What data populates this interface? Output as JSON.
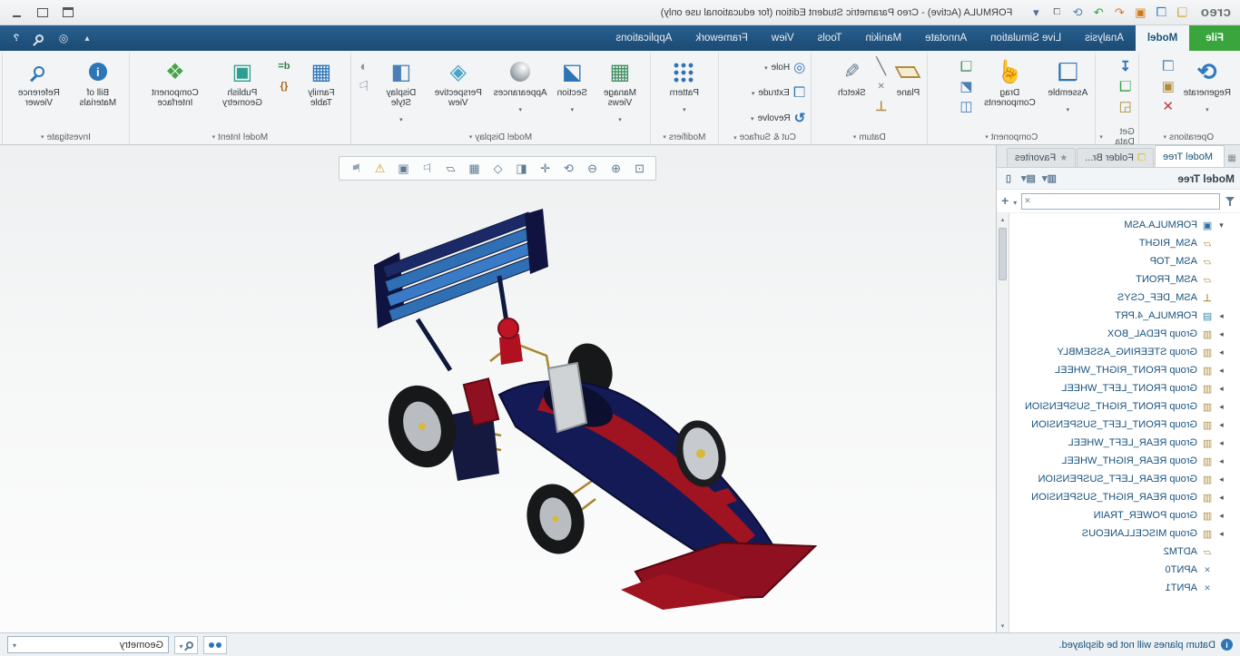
{
  "window": {
    "logo": "creo",
    "title": "FORMULA (Active) - Creo Parametric Student Edition (for educational use only)"
  },
  "qat_icons": [
    {
      "name": "new-icon",
      "glyph": "❏"
    },
    {
      "name": "open-icon",
      "glyph": "❒"
    },
    {
      "name": "save-icon",
      "glyph": "▣"
    },
    {
      "name": "undo-icon",
      "glyph": "↶"
    },
    {
      "name": "redo-icon",
      "glyph": "↷"
    },
    {
      "name": "regenerate-quick-icon",
      "glyph": "⟳"
    },
    {
      "name": "windows-icon",
      "glyph": "❐"
    },
    {
      "name": "customize-toolbar-icon",
      "glyph": "▾"
    }
  ],
  "tabbar_icon_names": [
    "minimize-ribbon-icon",
    "target-icon",
    "command-search-icon",
    "help-icon"
  ],
  "ribbon": {
    "tabs": [
      {
        "name": "tab-file",
        "label": "File",
        "state": "file"
      },
      {
        "name": "tab-model",
        "label": "Model",
        "state": "active"
      },
      {
        "name": "tab-analysis",
        "label": "Analysis",
        "state": "normal"
      },
      {
        "name": "tab-live-simulation",
        "label": "Live Simulation",
        "state": "normal"
      },
      {
        "name": "tab-annotate",
        "label": "Annotate",
        "state": "normal"
      },
      {
        "name": "tab-manikin",
        "label": "Manikin",
        "state": "normal"
      },
      {
        "name": "tab-tools",
        "label": "Tools",
        "state": "normal"
      },
      {
        "name": "tab-view",
        "label": "View",
        "state": "normal"
      },
      {
        "name": "tab-framework",
        "label": "Framework",
        "state": "normal"
      },
      {
        "name": "tab-applications",
        "label": "Applications",
        "state": "normal"
      }
    ],
    "groups": {
      "operations": {
        "label": "Operations",
        "regenerate": "Regenerate"
      },
      "get_data": {
        "label": "Get Data"
      },
      "component": {
        "label": "Component",
        "assemble": "Assemble",
        "drag": "Drag Components"
      },
      "datum": {
        "label": "Datum",
        "plane": "Plane",
        "sketch": "Sketch"
      },
      "cut_surface": {
        "label": "Cut & Surface",
        "hole": "Hole",
        "extrude": "Extrude",
        "revolve": "Revolve"
      },
      "modifiers": {
        "label": "Modifiers",
        "pattern": "Pattern"
      },
      "model_display": {
        "label": "Model Display",
        "manage_views": "Manage Views",
        "section": "Section",
        "appearances": "Appearances",
        "perspective": "Perspective View",
        "display_style": "Display Style"
      },
      "model_intent": {
        "label": "Model Intent",
        "family_table": "Family Table",
        "publish_geometry": "Publish Geometry",
        "component_interface": "Component Interface"
      },
      "investigate": {
        "label": "Investigate",
        "bom": "Bill of Materials",
        "reference_viewer": "Reference Viewer"
      }
    }
  },
  "navigator": {
    "tabs": [
      {
        "name": "tab-model-tree",
        "label": "Model Tree",
        "state": "active",
        "glyph": ""
      },
      {
        "name": "tab-folder-browser",
        "label": "Folder Br...",
        "state": "normal",
        "glyph": "❒"
      },
      {
        "name": "tab-favorites",
        "label": "Favorites",
        "state": "normal",
        "glyph": "★"
      }
    ],
    "panel_title": "Model Tree",
    "header_icons": [
      {
        "name": "tree-settings-icon",
        "glyph": "▥▾"
      },
      {
        "name": "tree-display-icon",
        "glyph": "▤▾"
      },
      {
        "name": "tree-column-icon",
        "glyph": "▯"
      }
    ],
    "search_value": ""
  },
  "tree": {
    "items": [
      {
        "label": "FORMULA.ASM",
        "type": "asm",
        "expander": "expanded"
      },
      {
        "label": "ASM_RIGHT",
        "type": "plane",
        "expander": "none"
      },
      {
        "label": "ASM_TOP",
        "type": "plane",
        "expander": "none"
      },
      {
        "label": "ASM_FRONT",
        "type": "plane",
        "expander": "none"
      },
      {
        "label": "ASM_DEF_CSYS",
        "type": "csys",
        "expander": "none"
      },
      {
        "label": "FORMULA_4.PRT",
        "type": "part",
        "expander": "collapsed"
      },
      {
        "label": "Group PEDAL_BOX",
        "type": "group",
        "expander": "collapsed"
      },
      {
        "label": "Group STEERING_ASSEMBLY",
        "type": "group",
        "expander": "collapsed"
      },
      {
        "label": "Group FRONT_RIGHT_WHEEL",
        "type": "group",
        "expander": "collapsed"
      },
      {
        "label": "Group FRONT_LEFT_WHEEL",
        "type": "group",
        "expander": "collapsed"
      },
      {
        "label": "Group FRONT_RIGHT_SUSPENSION",
        "type": "group",
        "expander": "collapsed"
      },
      {
        "label": "Group FRONT_LEFT_SUSPENSION",
        "type": "group",
        "expander": "collapsed"
      },
      {
        "label": "Group REAR_LEFT_WHEEL",
        "type": "group",
        "expander": "collapsed"
      },
      {
        "label": "Group REAR_RIGHT_WHEEL",
        "type": "group",
        "expander": "collapsed"
      },
      {
        "label": "Group REAR_LEFT_SUSPENSION",
        "type": "group",
        "expander": "collapsed"
      },
      {
        "label": "Group REAR_RIGHT_SUSPENSION",
        "type": "group",
        "expander": "collapsed"
      },
      {
        "label": "Group POWER_TRAIN",
        "type": "group",
        "expander": "collapsed"
      },
      {
        "label": "Group MISCELLANEOUS",
        "type": "group",
        "expander": "collapsed"
      },
      {
        "label": "ADTM2",
        "type": "plane",
        "expander": "none"
      },
      {
        "label": "APNT0",
        "type": "point",
        "expander": "none"
      },
      {
        "label": "APNT1",
        "type": "point",
        "expander": "none"
      }
    ]
  },
  "gfx_toolbar": {
    "icons": [
      {
        "name": "refit-icon",
        "glyph": "⊡"
      },
      {
        "name": "zoom-in-icon",
        "glyph": "⊕"
      },
      {
        "name": "zoom-out-icon",
        "glyph": "⊖"
      },
      {
        "name": "repaint-icon",
        "glyph": "⟳"
      },
      {
        "name": "spin-center-icon",
        "glyph": "✛"
      },
      {
        "name": "display-style-icon",
        "glyph": "◧"
      },
      {
        "name": "saved-orientations-icon",
        "glyph": "◇"
      },
      {
        "name": "view-manager-icon",
        "glyph": "▦"
      },
      {
        "name": "datum-display-filters-icon",
        "glyph": "▱"
      },
      {
        "name": "annotation-display-icon",
        "glyph": "⚐"
      },
      {
        "name": "capture-icon",
        "glyph": "▣"
      },
      {
        "name": "warning-icon",
        "glyph": "⚠"
      },
      {
        "name": "flag-icon",
        "glyph": "⚑"
      }
    ]
  },
  "status_bar": {
    "message": "Datum planes will not be displayed.",
    "filter_label": "Geometry"
  },
  "colors": {
    "ribbon_bar_navy": "#1c4a74",
    "file_tab_green": "#3aa53c",
    "accent_blue": "#2e75b6",
    "tree_text": "#17517c",
    "car_body_navy": "#141a55",
    "car_accent_red": "#a01320",
    "rear_wing_blue": "#2f6fb4"
  }
}
